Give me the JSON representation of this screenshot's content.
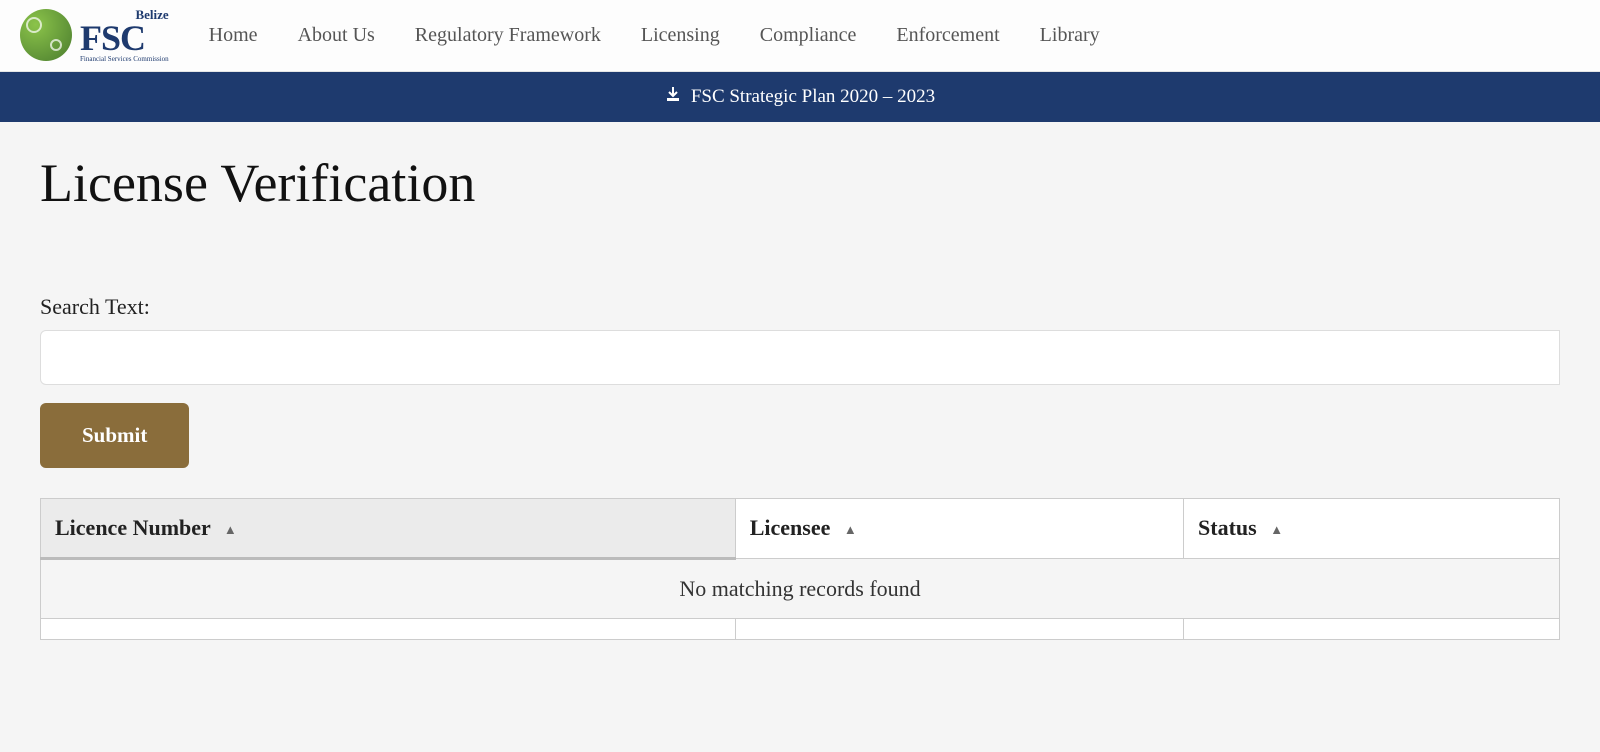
{
  "logo": {
    "belize": "Belize",
    "fsc": "FSC",
    "subtitle": "Financial Services Commission"
  },
  "nav": {
    "items": [
      {
        "label": "Home"
      },
      {
        "label": "About Us"
      },
      {
        "label": "Regulatory Framework"
      },
      {
        "label": "Licensing"
      },
      {
        "label": "Compliance"
      },
      {
        "label": "Enforcement"
      },
      {
        "label": "Library"
      }
    ]
  },
  "banner": {
    "text": "FSC Strategic Plan 2020 – 2023"
  },
  "page": {
    "title": "License Verification"
  },
  "search": {
    "label": "Search Text:",
    "value": "",
    "submit_label": "Submit"
  },
  "table": {
    "columns": [
      {
        "label": "Licence Number",
        "sorted": true
      },
      {
        "label": "Licensee",
        "sorted": false
      },
      {
        "label": "Status",
        "sorted": false
      }
    ],
    "empty_message": "No matching records found"
  }
}
